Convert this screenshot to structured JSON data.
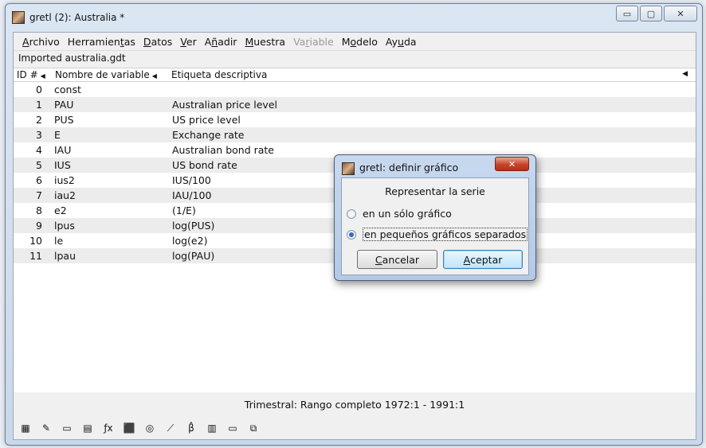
{
  "window": {
    "title": "gretl (2): Australia *",
    "minimize_glyph": "▭",
    "maximize_glyph": "▢",
    "close_glyph": "✕"
  },
  "menu": [
    {
      "pre": "",
      "u": "A",
      "post": "rchivo",
      "disabled": false
    },
    {
      "pre": "Herramien",
      "u": "t",
      "post": "as",
      "disabled": false
    },
    {
      "pre": "",
      "u": "D",
      "post": "atos",
      "disabled": false
    },
    {
      "pre": "",
      "u": "V",
      "post": "er",
      "disabled": false
    },
    {
      "pre": "A",
      "u": "ñ",
      "post": "adir",
      "disabled": false
    },
    {
      "pre": "",
      "u": "M",
      "post": "uestra",
      "disabled": false
    },
    {
      "pre": "Va",
      "u": "r",
      "post": "iable",
      "disabled": true
    },
    {
      "pre": "M",
      "u": "o",
      "post": "delo",
      "disabled": false
    },
    {
      "pre": "Ay",
      "u": "u",
      "post": "da",
      "disabled": false
    }
  ],
  "file_label": "Imported australia.gdt",
  "columns": {
    "id": "ID #",
    "name": "Nombre de variable",
    "label": "Etiqueta descriptiva"
  },
  "rows": [
    {
      "id": "0",
      "name": "const",
      "label": ""
    },
    {
      "id": "1",
      "name": "PAU",
      "label": "Australian price level"
    },
    {
      "id": "2",
      "name": "PUS",
      "label": "US price level"
    },
    {
      "id": "3",
      "name": "E",
      "label": "Exchange rate"
    },
    {
      "id": "4",
      "name": "IAU",
      "label": "Australian bond rate"
    },
    {
      "id": "5",
      "name": "IUS",
      "label": "US bond rate"
    },
    {
      "id": "6",
      "name": "ius2",
      "label": "IUS/100"
    },
    {
      "id": "7",
      "name": "iau2",
      "label": "IAU/100"
    },
    {
      "id": "8",
      "name": "e2",
      "label": "(1/E)"
    },
    {
      "id": "9",
      "name": "lpus",
      "label": "log(PUS)"
    },
    {
      "id": "10",
      "name": "le",
      "label": "log(e2)"
    },
    {
      "id": "11",
      "name": "lpau",
      "label": "log(PAU)"
    }
  ],
  "status": "Trimestral: Rango completo 1972:1 - 1991:1",
  "toolbar": [
    {
      "name": "calculator-icon",
      "glyph": "▦"
    },
    {
      "name": "script-editor-icon",
      "glyph": "✎"
    },
    {
      "name": "terminal-icon",
      "glyph": "▭"
    },
    {
      "name": "session-icon",
      "glyph": "▤"
    },
    {
      "name": "function-icon",
      "glyph": "ƒx"
    },
    {
      "name": "pdf-manual-icon",
      "glyph": "⬛"
    },
    {
      "name": "help-lifebuoy-icon",
      "glyph": "◎"
    },
    {
      "name": "plot-icon",
      "glyph": "⟋"
    },
    {
      "name": "model-beta-icon",
      "glyph": "β̂"
    },
    {
      "name": "database-icon",
      "glyph": "▥"
    },
    {
      "name": "folder-icon",
      "glyph": "▭"
    },
    {
      "name": "windows-icon",
      "glyph": "⧉"
    }
  ],
  "dialog": {
    "title": "gretl: definir gráfico",
    "close_glyph": "✕",
    "heading": "Representar la serie",
    "option1": "en un sólo gráfico",
    "option2": "en pequeños gráficos separados",
    "selected": 2,
    "cancel": {
      "u": "C",
      "post": "ancelar"
    },
    "accept": {
      "u": "A",
      "post": "ceptar"
    }
  },
  "colors": {
    "accent_radio": "#2d6cc4",
    "close_red": "#c6442a"
  }
}
